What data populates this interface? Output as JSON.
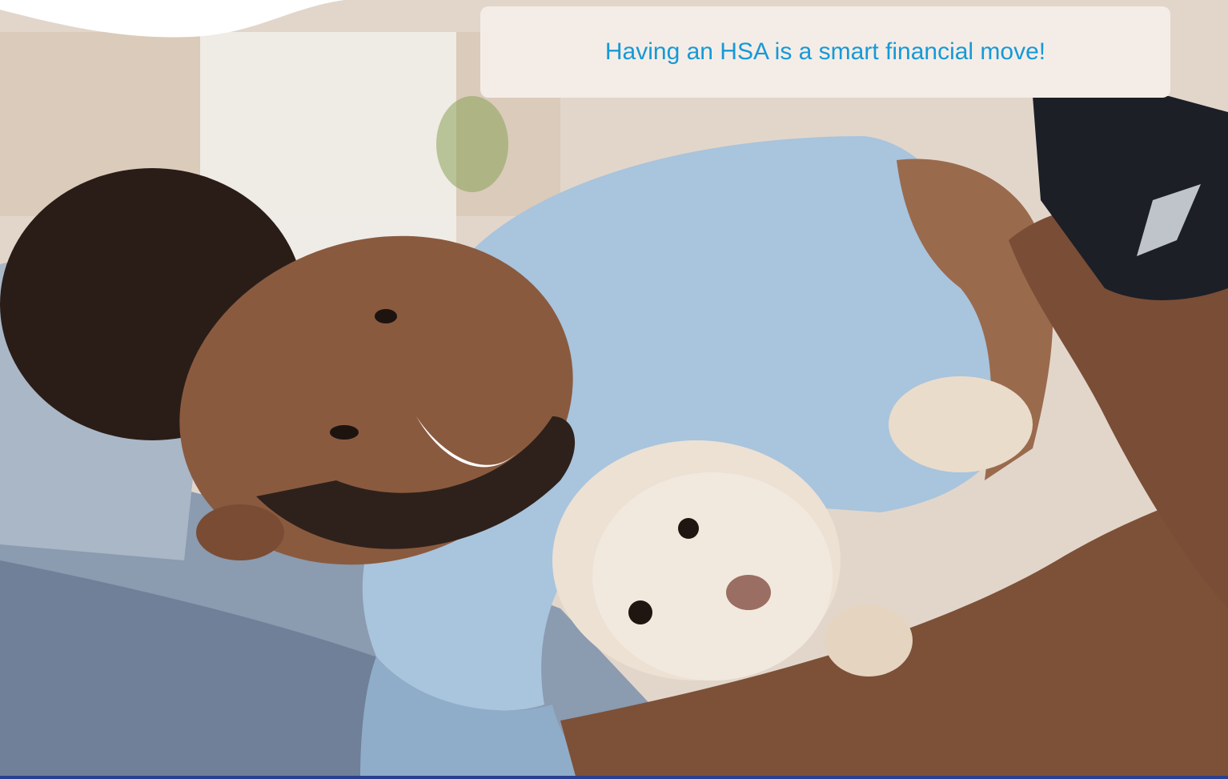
{
  "banner": {
    "text": "Having an HSA is a smart financial move!"
  },
  "colors": {
    "banner_background": "#f4ede7",
    "banner_text": "#1699d7",
    "wave": "#ffffff",
    "bottom_strip": "#2a3f8f"
  },
  "photo": {
    "subjects": "man lying on bed smiling with white dog, holding phone"
  }
}
